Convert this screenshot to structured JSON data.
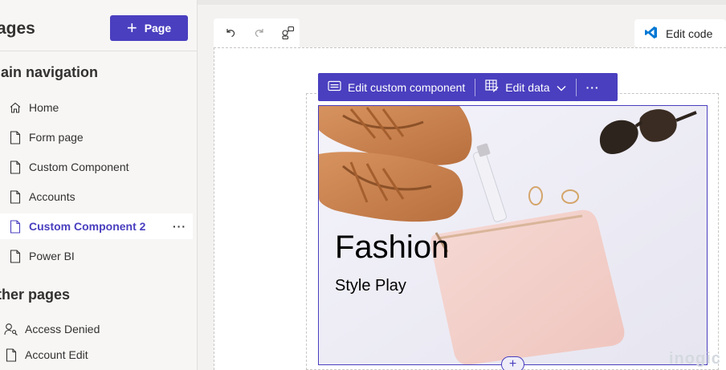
{
  "pages_panel": {
    "title": "ages",
    "add_page_label": "Page",
    "main_nav_title": "lain navigation",
    "main_nav": [
      {
        "label": "Home",
        "icon": "home-icon"
      },
      {
        "label": "Form page",
        "icon": "page-icon"
      },
      {
        "label": "Custom Component",
        "icon": "page-icon"
      },
      {
        "label": "Accounts",
        "icon": "page-icon"
      },
      {
        "label": "Custom Component 2",
        "icon": "page-icon",
        "selected": true
      },
      {
        "label": "Power BI",
        "icon": "page-icon"
      }
    ],
    "selected_more": "···",
    "other_pages_title": "ther pages",
    "other_pages": [
      {
        "label": "Access Denied",
        "icon": "person-key-icon"
      },
      {
        "label": "Account Edit",
        "icon": "page-icon"
      }
    ]
  },
  "canvas": {
    "edit_code_label": "Edit code"
  },
  "component_toolbar": {
    "edit_component_label": "Edit custom component",
    "edit_data_label": "Edit data",
    "more_label": "···"
  },
  "hero": {
    "title": "Fashion",
    "subtitle": "Style Play"
  },
  "add_section_label": "+",
  "watermark": "inogic",
  "colors": {
    "accent": "#4a3fbf",
    "vscode_blue": "#0078d4"
  }
}
